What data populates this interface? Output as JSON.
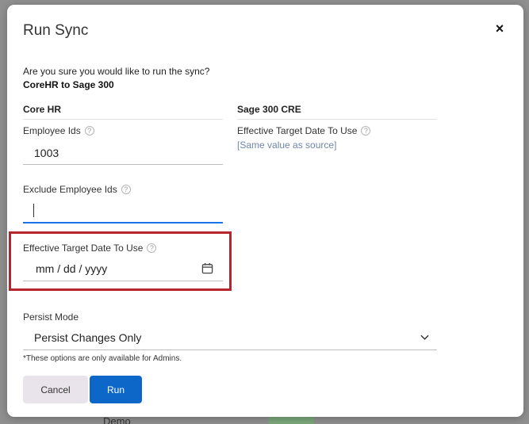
{
  "background": {
    "behind_text": "Demo"
  },
  "modal": {
    "title": "Run Sync",
    "confirm_text": "Are you sure you would like to run the sync?",
    "sync_name": "CoreHR to Sage 300"
  },
  "source": {
    "heading": "Core HR",
    "employee_ids_label": "Employee Ids",
    "employee_ids_value": "1003",
    "exclude_label": "Exclude Employee Ids",
    "exclude_value": "",
    "date_label": "Effective Target Date To Use",
    "date_placeholder": "mm / dd / yyyy"
  },
  "target": {
    "heading": "Sage 300 CRE",
    "date_label": "Effective Target Date To Use",
    "date_note": "[Same value as source]"
  },
  "persist": {
    "label": "Persist Mode",
    "selected": "Persist Changes Only",
    "note": "*These options are only available for Admins."
  },
  "actions": {
    "cancel": "Cancel",
    "run": "Run"
  },
  "help_glyph": "?",
  "colors": {
    "primary": "#0d67c9",
    "highlight": "#b3262d",
    "focus": "#1a73e8"
  }
}
